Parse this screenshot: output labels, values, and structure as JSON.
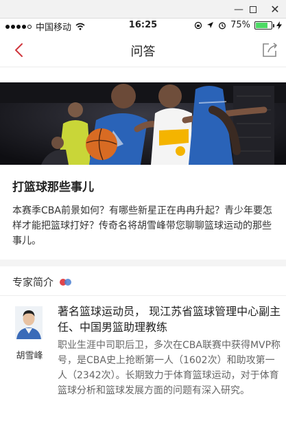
{
  "window": {
    "minimize": "—",
    "close": "✕"
  },
  "statusbar": {
    "carrier": "中国移动",
    "time": "16:25",
    "battery_percent": "75%",
    "battery_level": 0.75,
    "signal_bars": 4
  },
  "navbar": {
    "title": "问答"
  },
  "article": {
    "title": "打篮球那些事儿",
    "description": "本赛季CBA前景如何？有哪些新星正在冉冉升起？青少年要怎样才能把篮球打好？传奇名将胡雪峰带您聊聊篮球运动的那些事儿。"
  },
  "expert": {
    "section_title": "专家简介",
    "name": "胡雪峰",
    "headline": "著名篮球运动员， 现江苏省篮球管理中心副主任、中国男篮助理教练",
    "bio": "职业生涯中司职后卫，多次在CBA联赛中获得MVP称号，是CBA史上抢断第一人（1602次）和助攻第一人（2342次）。长期致力于体育篮球运动，对于体育篮球分析和篮球发展方面的问题有深入研究。"
  },
  "colors": {
    "accent": "#d0373d",
    "battery": "#4cd964",
    "jersey_blue": "#2a63b8",
    "jersey_yellow": "#f4b400"
  }
}
